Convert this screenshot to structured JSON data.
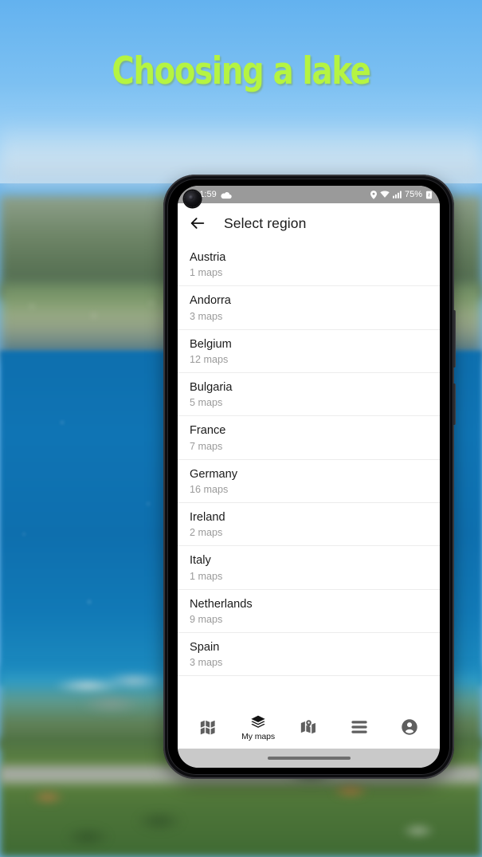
{
  "overlay": {
    "title": "Choosing a lake",
    "title_color": "#b5f442"
  },
  "background": {
    "description": "blurred aerial photo of an alpine lake with mountains"
  },
  "phone": {
    "status_bar": {
      "time": "11:59",
      "weather_icon": "cloud-icon",
      "location_icon": "location-pin-icon",
      "wifi_icon": "wifi-icon",
      "signal_icon": "cellular-signal-icon",
      "battery_text": "75%",
      "battery_icon": "battery-icon",
      "background_color": "#9a9a9a"
    },
    "app_bar": {
      "back_icon": "back-arrow-icon",
      "title": "Select region"
    },
    "regions": [
      {
        "name": "Austria",
        "count": "1 maps"
      },
      {
        "name": "Andorra",
        "count": "3 maps"
      },
      {
        "name": "Belgium",
        "count": "12 maps"
      },
      {
        "name": "Bulgaria",
        "count": "5 maps"
      },
      {
        "name": "France",
        "count": "7 maps"
      },
      {
        "name": "Germany",
        "count": "16 maps"
      },
      {
        "name": "Ireland",
        "count": "2 maps"
      },
      {
        "name": "Italy",
        "count": "1 maps"
      },
      {
        "name": "Netherlands",
        "count": "9 maps"
      },
      {
        "name": "Spain",
        "count": "3 maps"
      }
    ],
    "bottom_nav": [
      {
        "icon": "folded-map-icon",
        "label": "",
        "active": false
      },
      {
        "icon": "layers-icon",
        "label": "My maps",
        "active": true
      },
      {
        "icon": "map-pin-icon",
        "label": "",
        "active": false
      },
      {
        "icon": "hamburger-menu-icon",
        "label": "",
        "active": false
      },
      {
        "icon": "account-circle-icon",
        "label": "",
        "active": false
      }
    ]
  }
}
